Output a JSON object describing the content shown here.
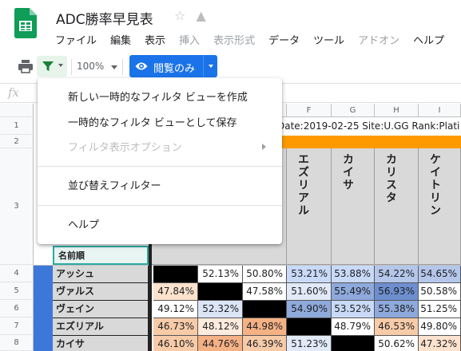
{
  "document": {
    "title": "ADC勝率早見表"
  },
  "menu": [
    "ファイル",
    "編集",
    "表示",
    "挿入",
    "表示形式",
    "データ",
    "ツール",
    "アドオン",
    "ヘルプ"
  ],
  "menu_disabled": [
    false,
    false,
    false,
    true,
    true,
    false,
    false,
    true,
    false
  ],
  "toolbar": {
    "zoom": "100%",
    "view_mode": "閲覧のみ"
  },
  "formula_bar": {
    "fx": "fx"
  },
  "columns": [
    "F",
    "G",
    "H",
    "I"
  ],
  "rows": [
    "1",
    "2",
    "3",
    "4",
    "5",
    "6",
    "7",
    "8"
  ],
  "sheet": {
    "meta_text": "Date:2019-02-25  Site:U.GG  Rank:Plati",
    "name_header": "名前順",
    "col_champions": [
      "エズリアル",
      "カイサ",
      "カリスタ",
      "ケイトリン"
    ],
    "champions": [
      "アッシュ",
      "ヴァルス",
      "ヴェイン",
      "エズリアル",
      "カイサ"
    ],
    "table": [
      [
        "",
        "52.13%",
        "50.80%",
        "53.21%",
        "53.88%",
        "54.22%",
        "54.65%"
      ],
      [
        "47.84%",
        "",
        "47.58%",
        "51.60%",
        "55.49%",
        "56.93%",
        "50.58%"
      ],
      [
        "49.12%",
        "52.32%",
        "",
        "54.90%",
        "53.52%",
        "55.38%",
        "51.25%"
      ],
      [
        "46.73%",
        "48.12%",
        "44.98%",
        "",
        "48.79%",
        "46.53%",
        "49.80%"
      ],
      [
        "46.10%",
        "44.76%",
        "46.39%",
        "51.23%",
        "",
        "50.62%",
        "47.32%"
      ]
    ],
    "colors": [
      [
        "#000000",
        "#ffffff",
        "#ffffff",
        "#c9daf8",
        "#c9daf8",
        "#b4c6ea",
        "#b4c6ea"
      ],
      [
        "#fde2cd",
        "#000000",
        "#ffffff",
        "#e2eaf8",
        "#8ea9db",
        "#6d8fcf",
        "#ffffff"
      ],
      [
        "#ffffff",
        "#dbe5f6",
        "#000000",
        "#8ea9db",
        "#c9daf8",
        "#8ea9db",
        "#ffffff"
      ],
      [
        "#f8cba8",
        "#fdebdd",
        "#f4b184",
        "#000000",
        "#ffffff",
        "#f8cba8",
        "#ffffff"
      ],
      [
        "#f8cba8",
        "#f4b184",
        "#f8cba8",
        "#e2eaf8",
        "#000000",
        "#ffffff",
        "#fde2cd"
      ]
    ]
  },
  "dropdown": {
    "items": [
      {
        "label": "新しい一時的なフィルタ ビューを作成",
        "disabled": false
      },
      {
        "label": "一時的なフィルタ ビューとして保存",
        "disabled": false
      },
      {
        "label": "フィルタ表示オプション",
        "disabled": true
      },
      {
        "label": "並び替えフィルター",
        "disabled": false
      },
      {
        "label": "ヘルプ",
        "disabled": false
      }
    ]
  },
  "colors": {
    "accent": "#1a73e8",
    "sheets_green": "#0f9d58",
    "filter_green": "#188038",
    "orange_band": "#ff9900",
    "blue_strip": "#3c78d8"
  }
}
